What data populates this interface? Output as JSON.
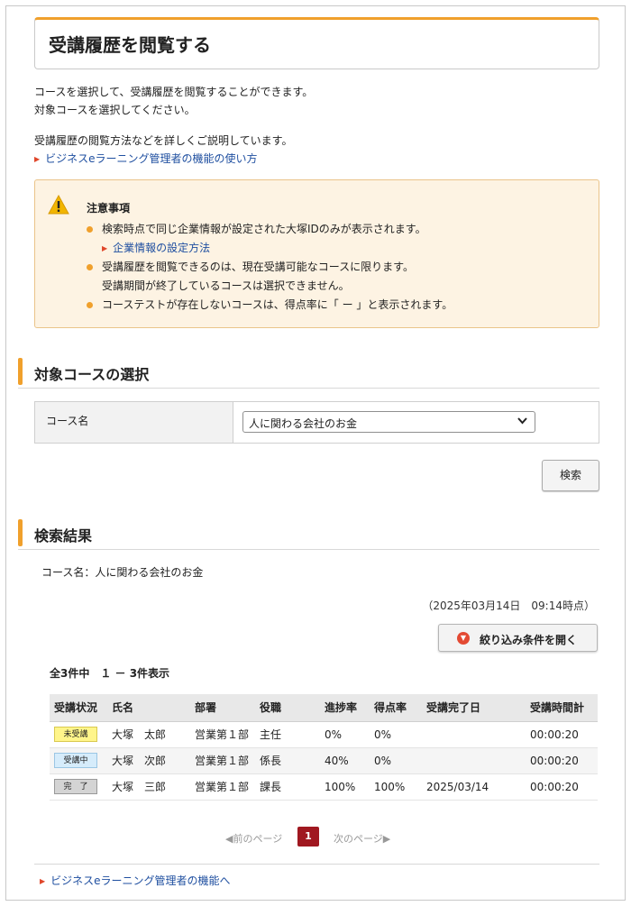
{
  "page": {
    "title": "受講履歴を閲覧する",
    "intro_line1": "コースを選択して、受講履歴を閲覧することができます。",
    "intro_line2": "対象コースを選択してください。",
    "help_text": "受講履歴の閲覧方法などを詳しくご説明しています。",
    "help_link": "ビジネスeラーニング管理者の機能の使い方"
  },
  "notice": {
    "title": "注意事項",
    "item1": "検索時点で同じ企業情報が設定された大塚IDのみが表示されます。",
    "item1_link": "企業情報の設定方法",
    "item2_line1": "受講履歴を閲覧できるのは、現在受講可能なコースに限ります。",
    "item2_line2": "受講期間が終了しているコースは選択できません。",
    "item3": "コーステストが存在しないコースは、得点率に「 ー 」と表示されます。"
  },
  "course_section": {
    "heading": "対象コースの選択",
    "label": "コース名",
    "selected": "人に関わる会社のお金",
    "search_button": "検索"
  },
  "results_section": {
    "heading": "検索結果",
    "course_line": "コース名：人に関わる会社のお金",
    "timestamp": "（2025年03月14日　09:14時点）",
    "filter_button": "絞り込み条件を開く",
    "count": "全3件中　１ － 3件表示",
    "columns": [
      "受講状況",
      "氏名",
      "部署",
      "役職",
      "進捗率",
      "得点率",
      "受講完了日",
      "受講時間計"
    ],
    "rows": [
      {
        "status": "未受講",
        "name": "大塚　太郎",
        "dept": "営業第１部",
        "role": "主任",
        "progress": "0%",
        "score": "0%",
        "done": "",
        "time": "00:00:20"
      },
      {
        "status": "受講中",
        "name": "大塚　次郎",
        "dept": "営業第１部",
        "role": "係長",
        "progress": "40%",
        "score": "0%",
        "done": "",
        "time": "00:00:20"
      },
      {
        "status": "完　了",
        "name": "大塚　三郎",
        "dept": "営業第１部",
        "role": "課長",
        "progress": "100%",
        "score": "100%",
        "done": "2025/03/14",
        "time": "00:00:20"
      }
    ]
  },
  "pager": {
    "prev": "前のページ",
    "current": "1",
    "next": "次のページ"
  },
  "footer": {
    "link": "ビジネスeラーニング管理者の機能へ"
  },
  "colors": {
    "accent": "#f0a02c",
    "link": "#1f4fa0",
    "pager_active": "#a01820"
  }
}
